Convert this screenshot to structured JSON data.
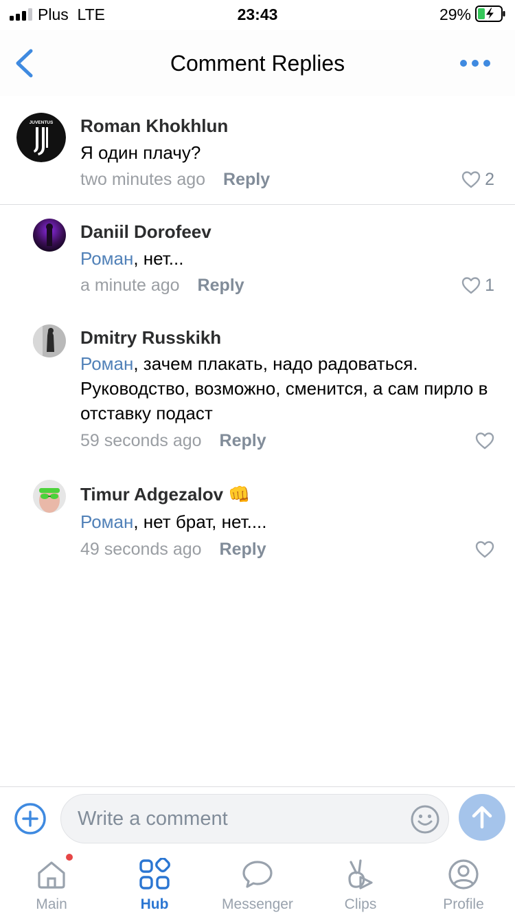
{
  "status_bar": {
    "carrier": "Plus",
    "network": "LTE",
    "time": "23:43",
    "battery_percent": "29%"
  },
  "header": {
    "title": "Comment Replies",
    "back_icon": "chevron-left-icon",
    "more_icon": "more-horizontal-icon"
  },
  "comments": [
    {
      "author": "Roman Khokhlun",
      "mention": "",
      "text": "Я один плачу?",
      "time": "two minutes ago",
      "reply_label": "Reply",
      "likes": "2",
      "avatar": "juventus-logo-avatar"
    },
    {
      "author": "Daniil Dorofeev",
      "mention": "Роман",
      "text": ", нет...",
      "time": "a minute ago",
      "reply_label": "Reply",
      "likes": "1",
      "avatar": "purple-photo-avatar"
    },
    {
      "author": "Dmitry Russkikh",
      "mention": "Роман",
      "text": ", зачем плакать, надо радоваться. Руководство, возможно, сменится, а сам пирло в отставку подаст",
      "time": "59 seconds ago",
      "reply_label": "Reply",
      "likes": "",
      "avatar": "gray-photo-avatar"
    },
    {
      "author": "Timur Adgezalov",
      "author_emoji": "👊",
      "mention": "Роман",
      "text": ", нет брат, нет....",
      "time": "49 seconds ago",
      "reply_label": "Reply",
      "likes": "",
      "avatar": "green-glasses-avatar"
    }
  ],
  "composer": {
    "placeholder": "Write a comment",
    "add_icon": "plus-circle-icon",
    "emoji_icon": "smile-icon",
    "send_icon": "arrow-up-icon"
  },
  "tabbar": {
    "tabs": [
      {
        "label": "Main",
        "icon": "home-icon",
        "badge": true
      },
      {
        "label": "Hub",
        "icon": "services-grid-icon",
        "active": true
      },
      {
        "label": "Messenger",
        "icon": "message-bubble-icon"
      },
      {
        "label": "Clips",
        "icon": "clips-icon"
      },
      {
        "label": "Profile",
        "icon": "user-circle-icon"
      }
    ]
  },
  "colors": {
    "accent": "#3f8ae0",
    "mention": "#5181b8",
    "meta": "#9a9ea3",
    "send_disabled": "#a5c4eb",
    "badge": "#e64646"
  }
}
